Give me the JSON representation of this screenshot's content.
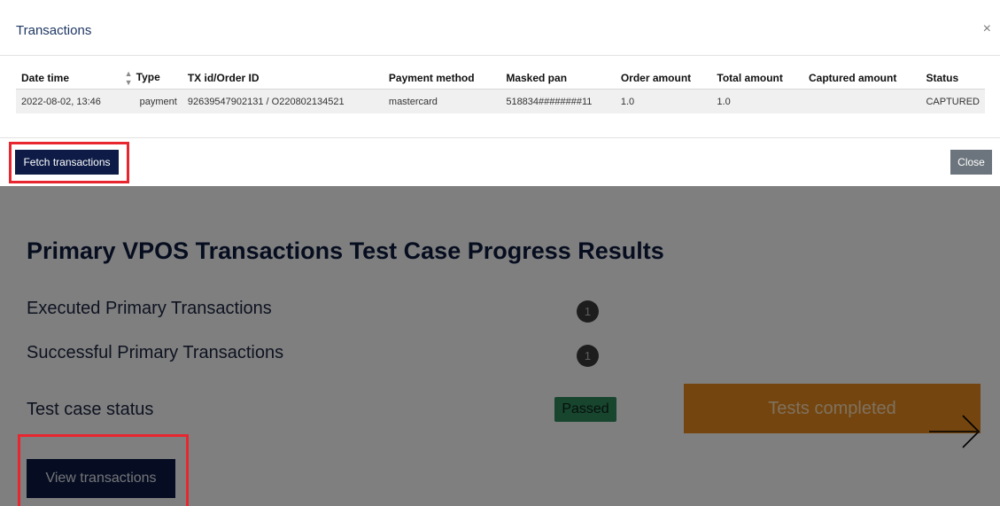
{
  "modal": {
    "title": "Transactions",
    "close_x": "×",
    "columns": [
      "Date time",
      "Type",
      "TX id/Order ID",
      "Payment method",
      "Masked pan",
      "Order amount",
      "Total amount",
      "Captured amount",
      "Status"
    ],
    "rows": [
      {
        "date_time": "2022-08-02, 13:46",
        "type": "payment",
        "tx_order_id": "92639547902131 / O220802134521",
        "payment_method": "mastercard",
        "masked_pan": "518834########11",
        "order_amount": "1.0",
        "total_amount": "1.0",
        "captured_amount": "",
        "status": "CAPTURED"
      }
    ],
    "fetch_label": "Fetch transactions",
    "close_label": "Close"
  },
  "page": {
    "title": "Primary VPOS Transactions Test Case Progress Results",
    "executed_label": "Executed Primary Transactions",
    "executed_count": "1",
    "successful_label": "Successful Primary Transactions",
    "successful_count": "1",
    "status_label": "Test case status",
    "status_badge": "Passed",
    "tests_status": "Tests completed",
    "view_transactions_label": "View transactions"
  },
  "colors": {
    "primary": "#0d1b46",
    "highlight": "#e8262f",
    "passed": "#2e8a5c",
    "progress": "#e88a1d",
    "secondary": "#6c757d"
  },
  "icons": {
    "sort": "sort-icon",
    "close": "close-icon",
    "arrow": "arrow-right-icon"
  }
}
